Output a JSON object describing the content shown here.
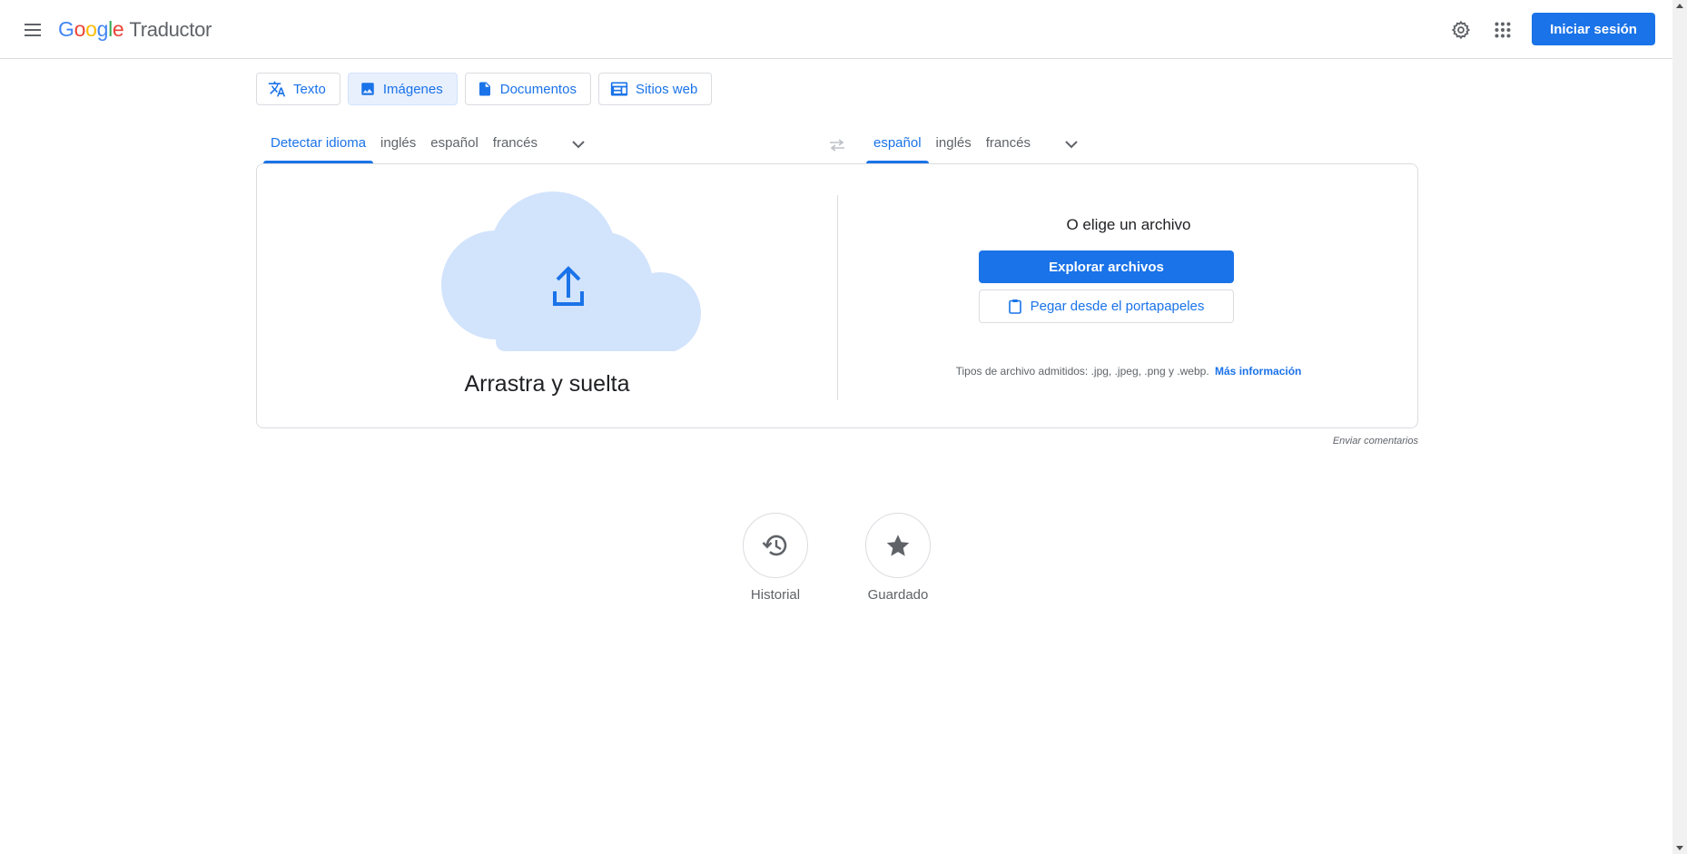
{
  "header": {
    "logo_letters": [
      "G",
      "o",
      "o",
      "g",
      "l",
      "e"
    ],
    "product_name": "Traductor",
    "signin_label": "Iniciar sesión",
    "icons": {
      "menu": "hamburger-menu-icon",
      "settings": "gear-icon",
      "apps": "apps-grid-icon"
    }
  },
  "mode_tabs": [
    {
      "label": "Texto",
      "icon": "translate-icon",
      "active": false
    },
    {
      "label": "Imágenes",
      "icon": "image-icon",
      "active": true
    },
    {
      "label": "Documentos",
      "icon": "document-icon",
      "active": false
    },
    {
      "label": "Sitios web",
      "icon": "website-icon",
      "active": false
    }
  ],
  "source_languages": [
    "Detectar idioma",
    "inglés",
    "español",
    "francés"
  ],
  "source_active": "Detectar idioma",
  "target_languages": [
    "español",
    "inglés",
    "francés"
  ],
  "target_active": "español",
  "upload": {
    "drop_label": "Arrastra y suelta",
    "choose_label": "O elige un archivo",
    "browse_label": "Explorar archivos",
    "paste_label": "Pegar desde el portapapeles",
    "filetypes_text": "Tipos de archivo admitidos: .jpg, .jpeg, .png y .webp.",
    "more_info_label": "Más información"
  },
  "feedback_label": "Enviar comentarios",
  "actions": {
    "history_label": "Historial",
    "saved_label": "Guardado"
  },
  "colors": {
    "accent": "#1a73e8",
    "cloud": "#d2e3fc",
    "border": "#dadce0"
  }
}
